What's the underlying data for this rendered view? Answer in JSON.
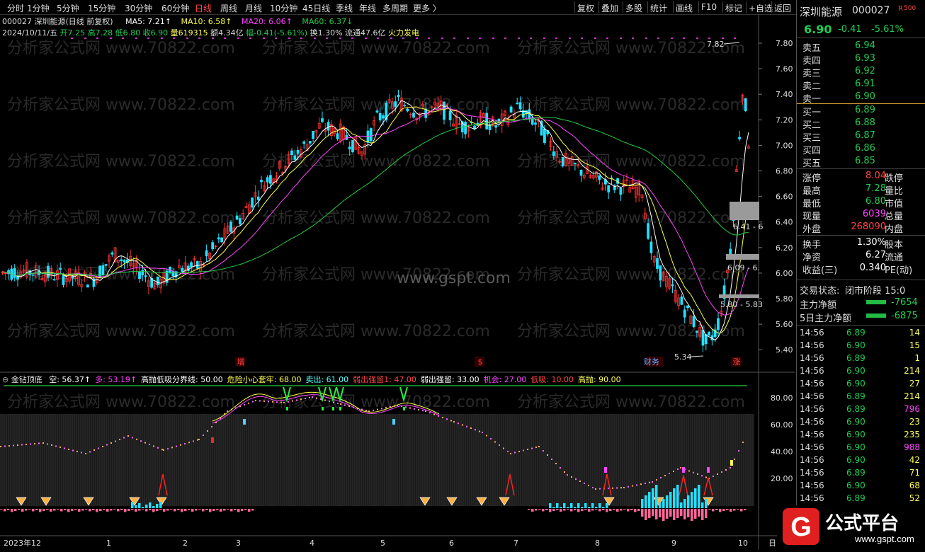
{
  "toolbar": {
    "periods": [
      "分时",
      "1分钟",
      "5分钟",
      "15分钟",
      "30分钟",
      "60分钟",
      "日线",
      "周线",
      "月线",
      "10分钟",
      "45日线",
      "季线",
      "年线",
      "多周期",
      "更多 〉"
    ],
    "active_period": "日线",
    "right_buttons": [
      "复权",
      "叠加",
      "多股",
      "统计",
      "画线",
      "F10",
      "标记",
      "+自选",
      "返回"
    ]
  },
  "chart_header": {
    "title": "000027 深圳能源(日线 前复权)",
    "ma5": "MA5: 7.21↑",
    "ma10": "MA10: 6.58↑",
    "ma20": "MA20: 6.06↑",
    "ma60": "MA60: 6.37↓",
    "date": "2024/10/11/五",
    "open": "开7.25",
    "high": "高7.28",
    "low": "低6.80",
    "close": "收6.90",
    "volume": "量619315",
    "amount": "额4.34亿",
    "change": "幅-0.41(-5.61%)",
    "turnover": "换1.30%",
    "float": "流通47.6亿",
    "sector": "火力发电"
  },
  "price_axis": [
    "7.80",
    "7.60",
    "7.40",
    "7.20",
    "7.00",
    "6.80",
    "6.60",
    "6.40",
    "6.20",
    "6.00",
    "5.80",
    "5.60",
    "5.40"
  ],
  "price_annotations": {
    "high_mark": "7.82",
    "low_mark": "5.34",
    "level1": "6.41 - 6",
    "level2": "6.09 - 6.",
    "level3": "5.80 - 5.83"
  },
  "event_markers": [
    "增",
    "$",
    "财务",
    "涨"
  ],
  "watermarks": {
    "site": "分析家公式网 www.70822.com",
    "center": "www.gspt.com"
  },
  "indicator_header": {
    "name": "金钻顶底",
    "items": [
      {
        "text": "空: 56.37↑",
        "color": "#ffffff"
      },
      {
        "text": "多: 53.19↑",
        "color": "#ff44ff"
      },
      {
        "text": "高抛低吸分界线: 50.00",
        "color": "#ffffff"
      },
      {
        "text": "危险小心套牢: 68.00",
        "color": "#ffff55"
      },
      {
        "text": "卖出: 61.00",
        "color": "#55ffff"
      },
      {
        "text": "弱出强留1: 47.00",
        "color": "#ff4444"
      },
      {
        "text": "弱出强留: 33.00",
        "color": "#ffffff"
      },
      {
        "text": "机会: 27.00",
        "color": "#ff44ff"
      },
      {
        "text": "低吸: 10.00",
        "color": "#ff4444"
      },
      {
        "text": "高抛: 90.00",
        "color": "#ffff55"
      }
    ]
  },
  "indicator_axis": [
    "80.00",
    "60.00",
    "40.00",
    "20.00"
  ],
  "date_axis": [
    "2023年12",
    "1",
    "2",
    "3",
    "4",
    "5",
    "6",
    "7",
    "8",
    "9",
    "10",
    "日"
  ],
  "quote": {
    "name": "深圳能源",
    "code": "000027",
    "badge": "R",
    "badge_num": "500",
    "price": "6.90",
    "change": "-0.41",
    "pct": "-5.61%",
    "sell": [
      {
        "label": "卖五",
        "price": "6.94"
      },
      {
        "label": "卖四",
        "price": "6.93"
      },
      {
        "label": "卖三",
        "price": "6.92"
      },
      {
        "label": "卖二",
        "price": "6.91"
      },
      {
        "label": "卖一",
        "price": "6.90"
      }
    ],
    "buy": [
      {
        "label": "买一",
        "price": "6.89"
      },
      {
        "label": "买二",
        "price": "6.88"
      },
      {
        "label": "买三",
        "price": "6.87"
      },
      {
        "label": "买四",
        "price": "6.86"
      },
      {
        "label": "买五",
        "price": "6.85"
      }
    ],
    "stats": [
      {
        "l": "涨停",
        "v": "8.04",
        "vc": "#ff4444",
        "r": "跌停"
      },
      {
        "l": "最高",
        "v": "7.28",
        "vc": "#22cc55",
        "r": "量比"
      },
      {
        "l": "最低",
        "v": "6.80",
        "vc": "#22cc55",
        "r": "市值"
      },
      {
        "l": "现量",
        "v": "6039",
        "vc": "#ff44ff",
        "r": "总量"
      },
      {
        "l": "外盘",
        "v": "268090",
        "vc": "#ff4444",
        "r": "内盘"
      },
      {
        "l": "换手",
        "v": "1.30%",
        "vc": "#ffffff",
        "r": "股本"
      },
      {
        "l": "净资",
        "v": "6.27",
        "vc": "#ffffff",
        "r": "流通"
      },
      {
        "l": "收益(三)",
        "v": "0.340",
        "vc": "#ffffff",
        "r": "PE(动)"
      }
    ],
    "trade_status_label": "交易状态:",
    "trade_status": "闭市阶段 15:0",
    "main_net_label": "主力净额",
    "main_net": "-7654",
    "main5_label": "5日主力净额",
    "main5": "-6875",
    "ticks": [
      {
        "t": "14:56",
        "p": "6.89",
        "v": "14",
        "vc": "#ffff55"
      },
      {
        "t": "14:56",
        "p": "6.90",
        "v": "15",
        "vc": "#ffff55"
      },
      {
        "t": "14:56",
        "p": "6.89",
        "v": "1",
        "vc": "#ffff55"
      },
      {
        "t": "14:56",
        "p": "6.90",
        "v": "214",
        "vc": "#ffff55"
      },
      {
        "t": "14:56",
        "p": "6.90",
        "v": "27",
        "vc": "#ffff55"
      },
      {
        "t": "14:56",
        "p": "6.89",
        "v": "214",
        "vc": "#ffff55"
      },
      {
        "t": "14:56",
        "p": "6.89",
        "v": "796",
        "vc": "#ff44ff"
      },
      {
        "t": "14:56",
        "p": "6.90",
        "v": "23",
        "vc": "#ffff55"
      },
      {
        "t": "14:56",
        "p": "6.90",
        "v": "235",
        "vc": "#ffff55"
      },
      {
        "t": "14:56",
        "p": "6.90",
        "v": "988",
        "vc": "#ff44ff"
      },
      {
        "t": "14:56",
        "p": "6.90",
        "v": "42",
        "vc": "#ffff55"
      },
      {
        "t": "14:56",
        "p": "6.89",
        "v": "71",
        "vc": "#ffff55"
      },
      {
        "t": "14:56",
        "p": "6.90",
        "v": "68",
        "vc": "#ffff55"
      },
      {
        "t": "14:56",
        "p": "6.89",
        "v": "52",
        "vc": "#ffff55"
      }
    ]
  },
  "logo": {
    "text": "公式平台",
    "url": "www.gspt.com"
  },
  "colors": {
    "up": "#ff3333",
    "down": "#22e0ff",
    "ma5": "#ffffff",
    "ma10": "#ffff44",
    "ma20": "#ff44ff",
    "ma60": "#22cc44",
    "accent_red": "#ff4b4b",
    "green": "#22cc55"
  }
}
